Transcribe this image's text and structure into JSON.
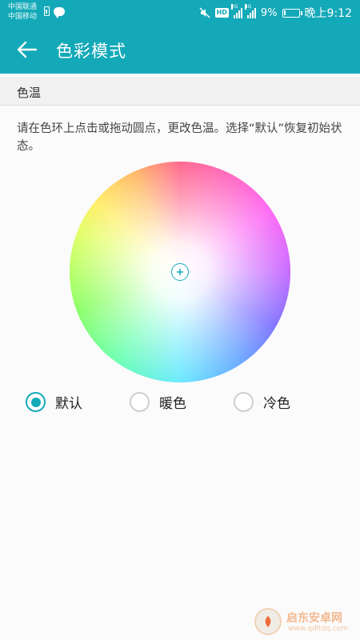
{
  "status_bar": {
    "carrier_line1": "中国联通",
    "carrier_line2": "中国移动",
    "hd_badge": "HD",
    "signal1_tag": "2G",
    "signal2_tag": "4G",
    "battery_percent": "9%",
    "time": "晚上9:12"
  },
  "header": {
    "title": "色彩模式",
    "back_icon": "arrow-left-icon"
  },
  "section": {
    "title": "色温"
  },
  "description": "请在色环上点击或拖动圆点，更改色温。选择“默认”恢复初始状态。",
  "options": [
    {
      "label": "默认",
      "checked": true
    },
    {
      "label": "暖色",
      "checked": false
    },
    {
      "label": "冷色",
      "checked": false
    }
  ],
  "watermark": {
    "text": "启东安卓网",
    "url": "www.qdltdq.com"
  },
  "colors": {
    "accent": "#14a9b8",
    "background": "#fbfbfb",
    "section_bar": "#f1f1f1"
  }
}
